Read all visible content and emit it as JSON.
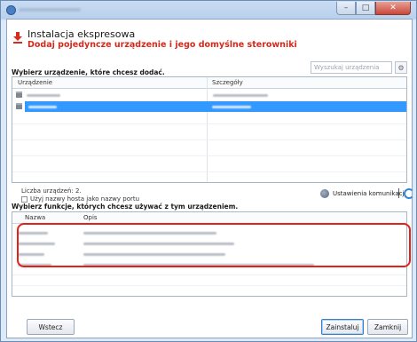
{
  "header": {
    "title": "Instalacja ekspresowa",
    "subtitle": "Dodaj pojedyncze urządzenie i jego domyślne sterowniki"
  },
  "devices": {
    "prompt": "Wybierz urządzenie, które chcesz dodać.",
    "search_placeholder": "Wyszukaj urządzenia",
    "columns": [
      "Urządzenie",
      "Szczegóły"
    ],
    "count_label": "Liczba urządzeń: 2.",
    "hostname_checkbox_label": "Użyj nazwy hosta jako nazwy portu",
    "comm_settings_label": "Ustawienia komunikacji"
  },
  "functions": {
    "prompt": "Wybierz funkcje, których chcesz używać z tym urządzeniem.",
    "columns": [
      "Nazwa",
      "Opis"
    ]
  },
  "buttons": {
    "back": "Wstecz",
    "install": "Zainstaluj",
    "close": "Zamknij"
  },
  "colors": {
    "accent_red": "#d42a1c",
    "selection_blue": "#3399ff"
  }
}
